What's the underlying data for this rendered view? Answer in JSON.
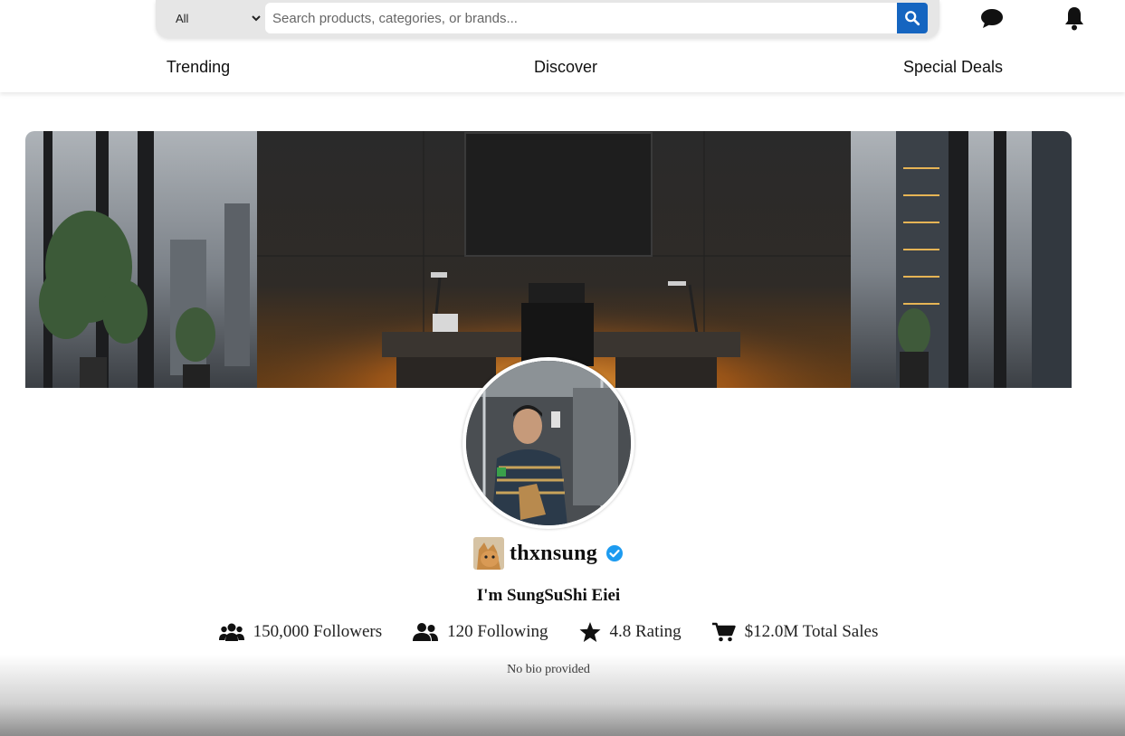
{
  "search": {
    "category_value": "All",
    "placeholder": "Search products, categories, or brands...",
    "search_icon": "search-icon"
  },
  "header_icons": {
    "messages": "chat-bubble-icon",
    "notifications": "bell-icon"
  },
  "nav": {
    "trending": "Trending",
    "discover": "Discover",
    "special_deals": "Special Deals"
  },
  "profile": {
    "username": "thxnsung",
    "verified": true,
    "tagline": "I'm SungSuShi Eiei",
    "bio": "No bio provided"
  },
  "stats": {
    "followers": "150,000 Followers",
    "following": "120 Following",
    "rating": "4.8 Rating",
    "total_sales": "$12.0M Total Sales"
  },
  "colors": {
    "accent_blue": "#1565c0",
    "verified_blue": "#1d9bf0"
  }
}
